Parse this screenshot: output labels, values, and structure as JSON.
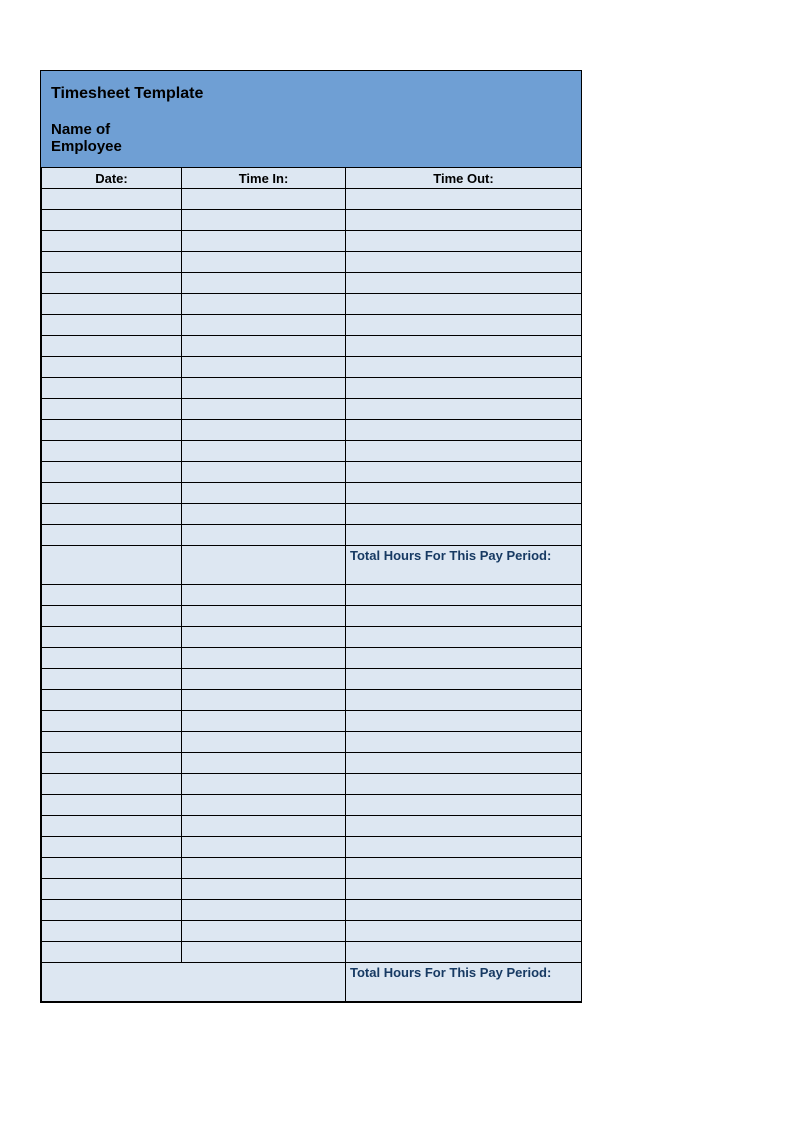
{
  "header": {
    "title": "Timesheet Template",
    "subtitle_line1": "Name of",
    "subtitle_line2": "Employee"
  },
  "columns": {
    "date": "Date:",
    "time_in": "Time In:",
    "time_out": "Time Out:"
  },
  "labels": {
    "total_hours": "Total Hours For This Pay Period:"
  },
  "rows_section1": 17,
  "rows_section2": 18
}
